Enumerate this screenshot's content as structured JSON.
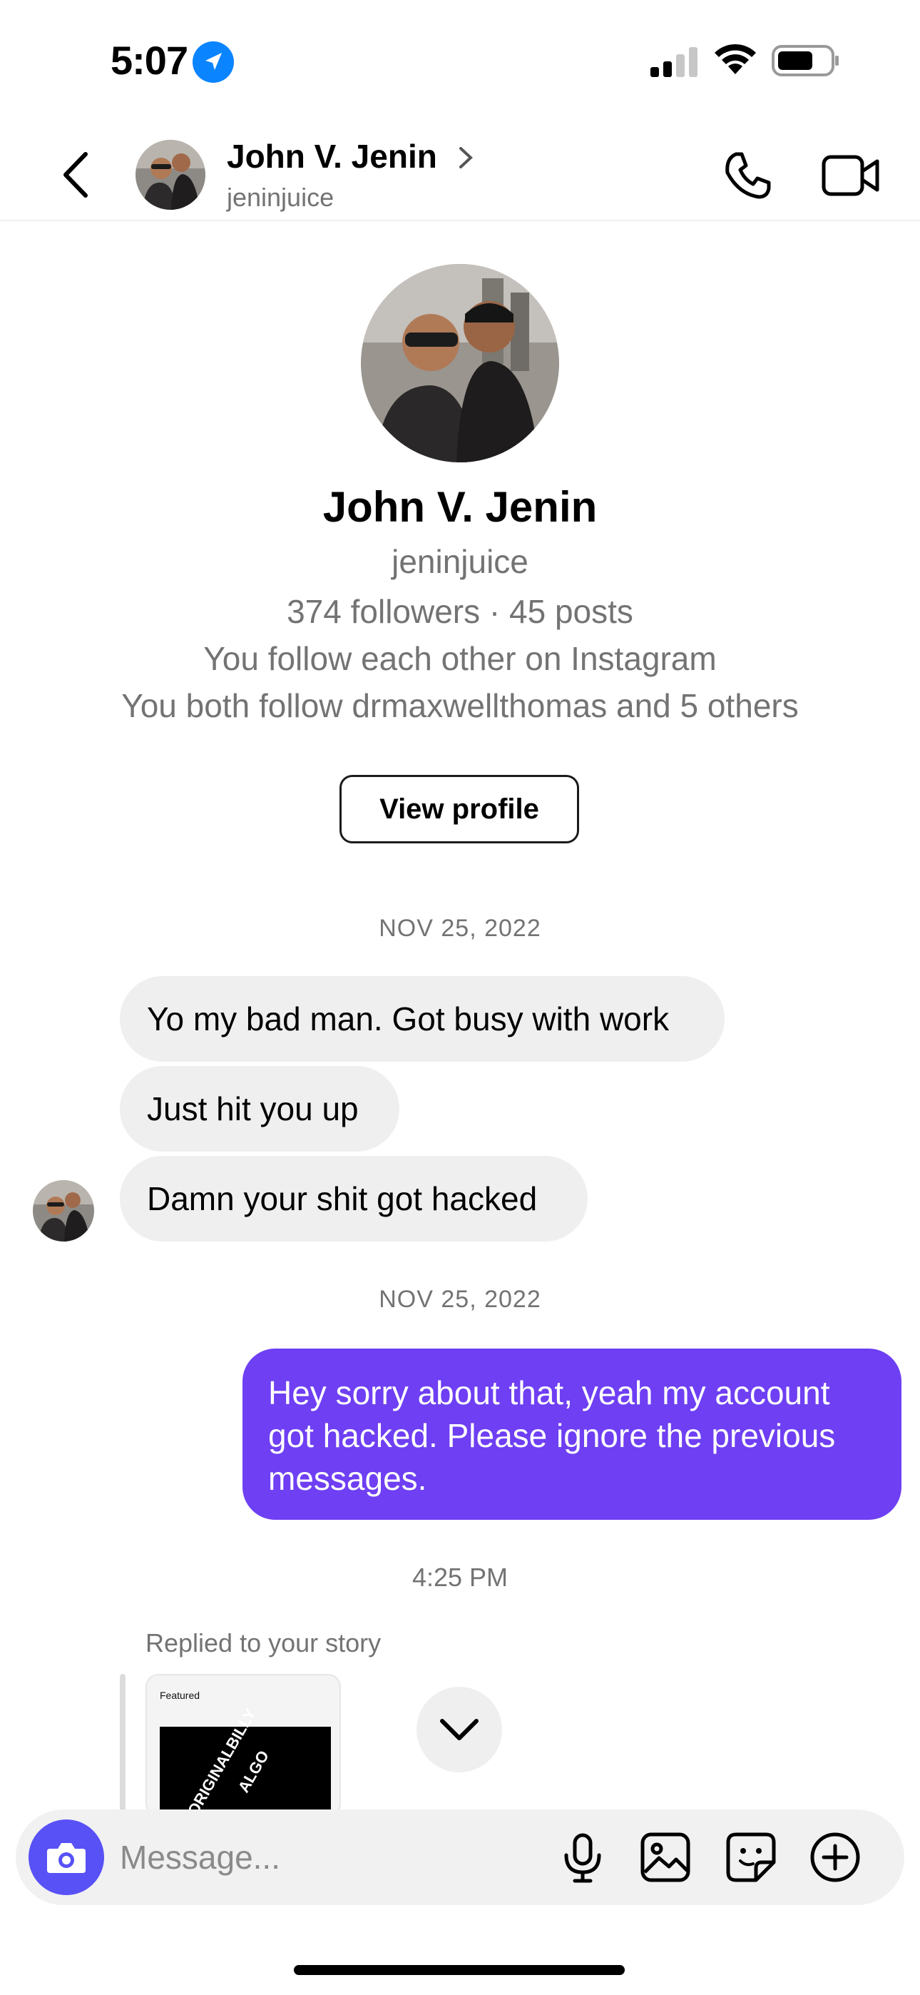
{
  "status_bar": {
    "time": "5:07"
  },
  "header": {
    "name": "John V. Jenin",
    "username": "jeninjuice"
  },
  "profile": {
    "name": "John V. Jenin",
    "username": "jeninjuice",
    "stats": "374 followers · 45 posts",
    "mutual_follow": "You follow each other on Instagram",
    "mutual_friends": "You both follow drmaxwellthomas and 5 others",
    "view_profile_label": "View profile"
  },
  "thread": {
    "date_1": "NOV 25, 2022",
    "received": [
      "Yo my bad man. Got busy with work",
      "Just hit you up",
      "Damn your shit got hacked"
    ],
    "date_2": "NOV 25, 2022",
    "sent": "Hey sorry about that, yeah my account got hacked. Please ignore the previous messages.",
    "time_3": "4:25 PM",
    "replied_label": "Replied to your story",
    "story": {
      "featured_label": "Featured",
      "text_1": "OFORIGINALBILLY",
      "text_2": "ALGO"
    }
  },
  "composer": {
    "placeholder": "Message..."
  },
  "colors": {
    "sent_bubble": "#6e3ff3",
    "received_bubble": "#efefef",
    "camera_button": "#5851f6",
    "location_blue": "#0a84ff"
  },
  "icons": [
    "location-icon",
    "signal-icon",
    "wifi-icon",
    "battery-icon",
    "back-icon",
    "chevron-right-icon",
    "phone-icon",
    "video-icon",
    "chevron-down-icon",
    "camera-icon",
    "microphone-icon",
    "gallery-icon",
    "sticker-icon",
    "plus-icon"
  ]
}
